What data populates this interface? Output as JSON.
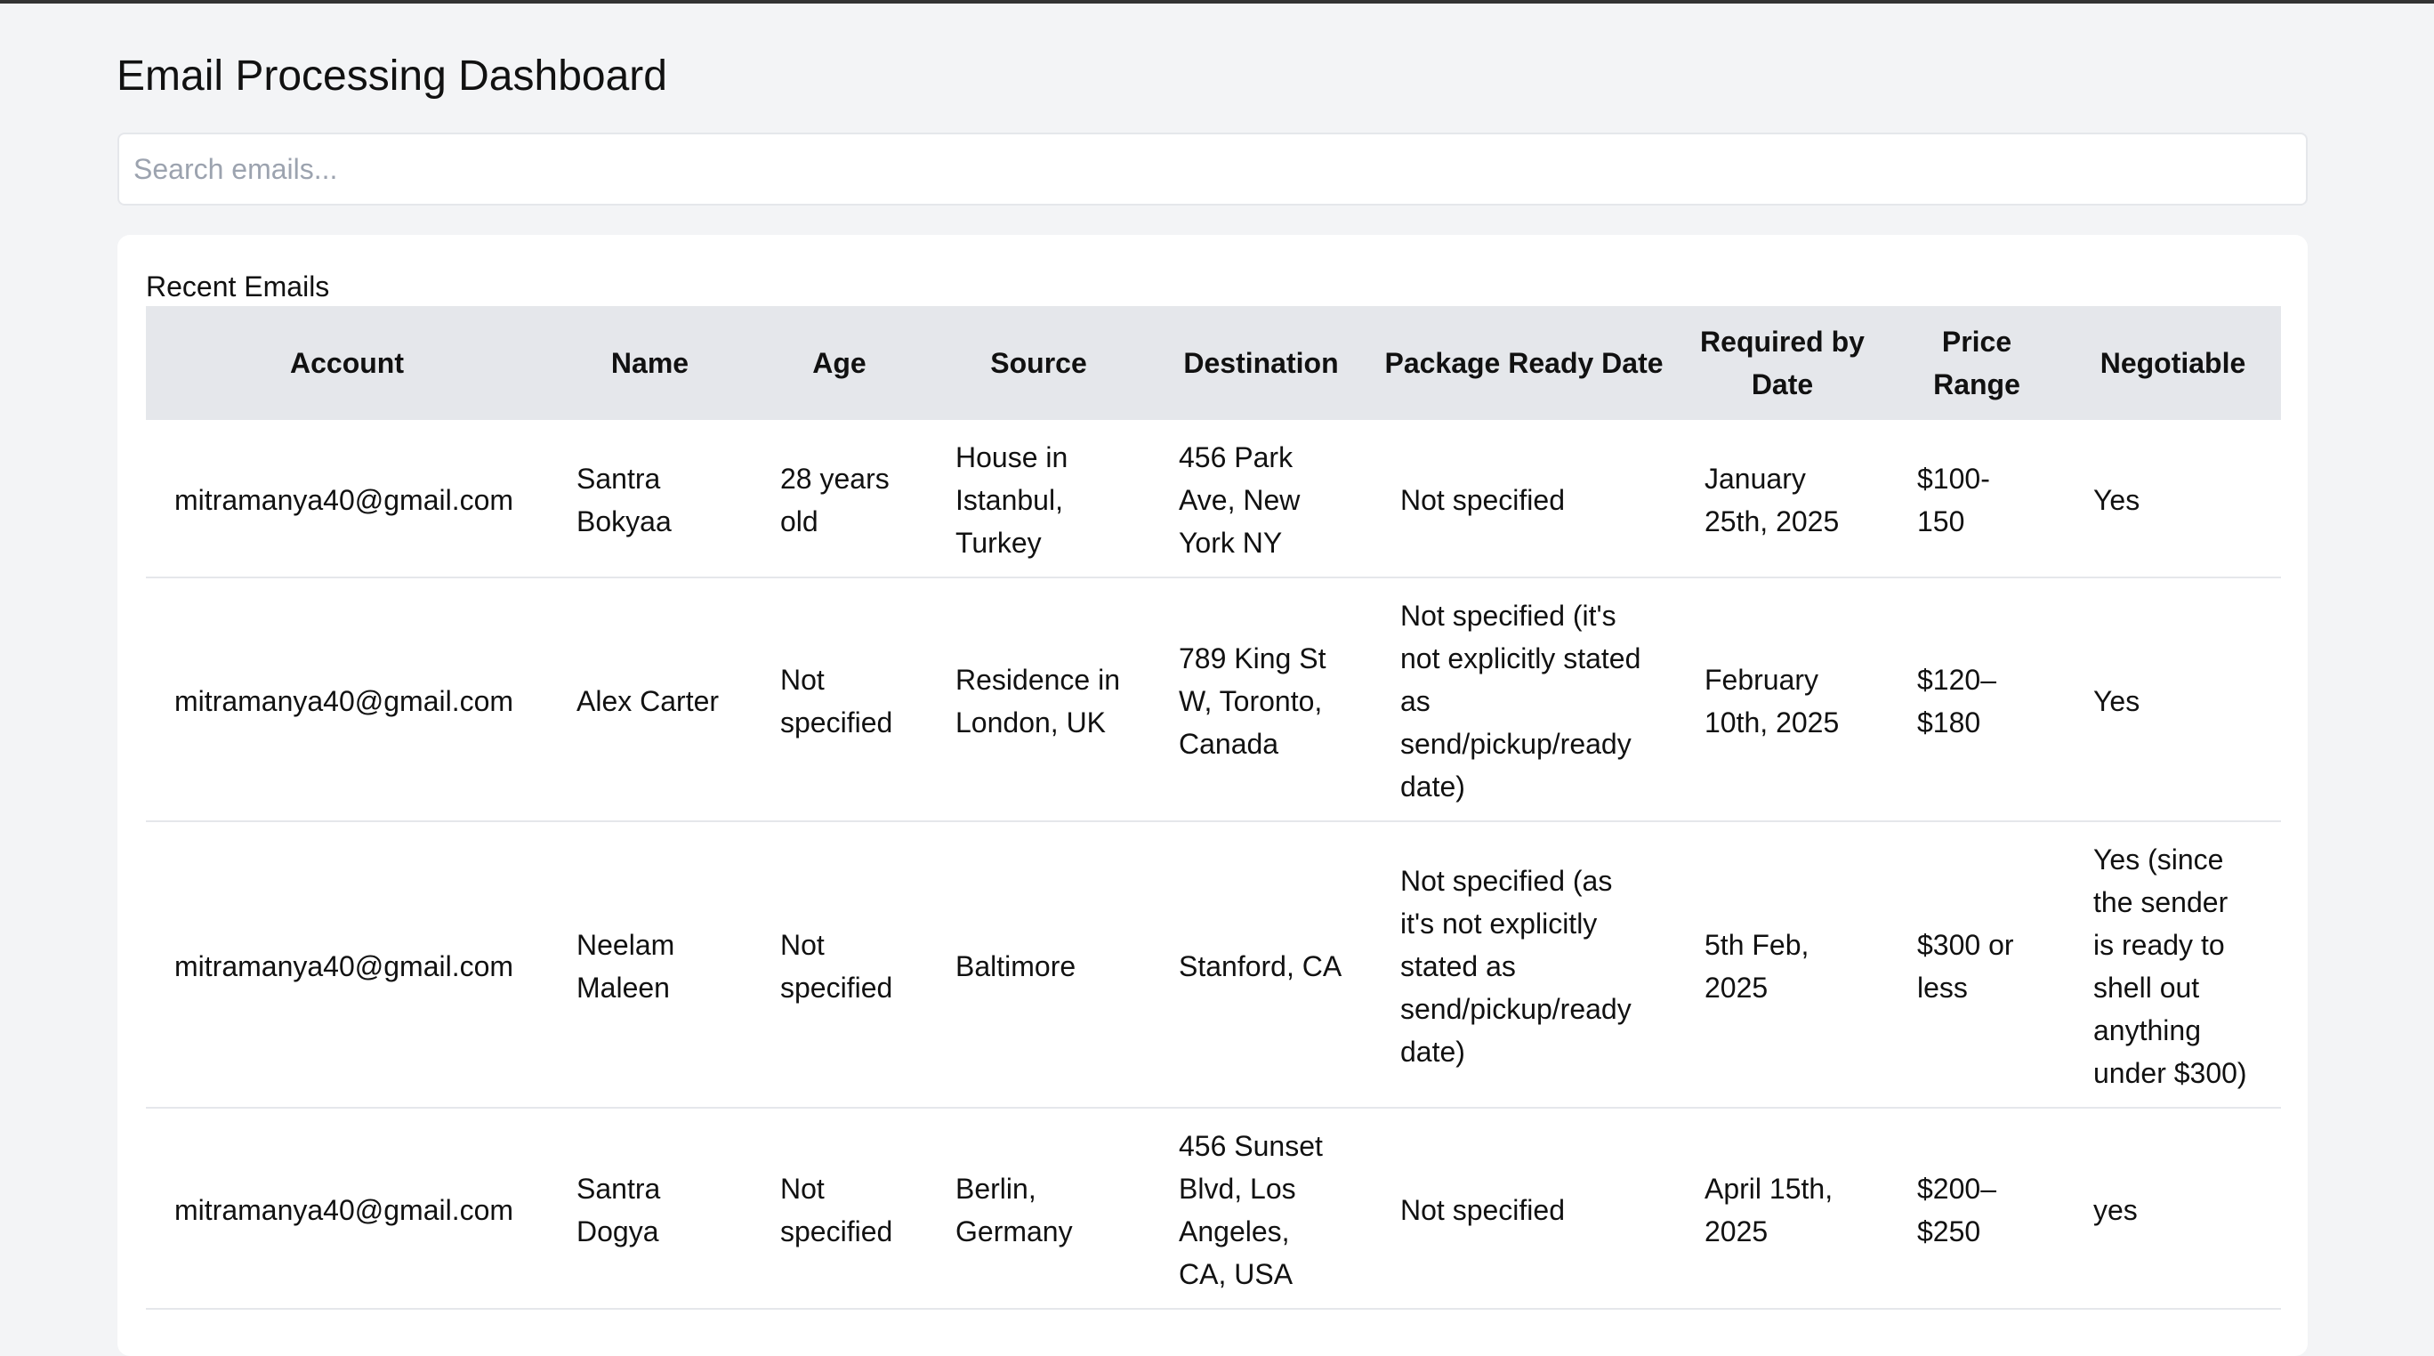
{
  "page": {
    "title": "Email Processing Dashboard"
  },
  "search": {
    "placeholder": "Search emails...",
    "value": ""
  },
  "card": {
    "title": "Recent Emails"
  },
  "table": {
    "columns": [
      "Account",
      "Name",
      "Age",
      "Source",
      "Destination",
      "Package Ready Date",
      "Required by Date",
      "Price Range",
      "Negotiable"
    ],
    "rows": [
      [
        "mitramanya40@gmail.com",
        "Santra Bokyaa",
        "28 years old",
        "House in Istanbul, Turkey",
        "456 Park Ave, New York NY",
        "Not specified",
        "January 25th, 2025",
        "$100-150",
        "Yes"
      ],
      [
        "mitramanya40@gmail.com",
        "Alex Carter",
        "Not specified",
        "Residence in London, UK",
        "789 King St W, Toronto, Canada",
        "Not specified (it's not explicitly stated as send/pickup/ready date)",
        "February 10th, 2025",
        "$120–$180",
        "Yes"
      ],
      [
        "mitramanya40@gmail.com",
        "Neelam Maleen",
        "Not specified",
        "Baltimore",
        "Stanford, CA",
        "Not specified (as it's not explicitly stated as send/pickup/ready date)",
        "5th Feb, 2025",
        "$300 or less",
        "Yes (since the sender is ready to shell out anything under $300)"
      ],
      [
        "mitramanya40@gmail.com",
        "Santra Dogya",
        "Not specified",
        "Berlin, Germany",
        "456 Sunset Blvd, Los Angeles, CA, USA",
        "Not specified",
        "April 15th, 2025",
        "$200–$250",
        "yes"
      ]
    ]
  }
}
